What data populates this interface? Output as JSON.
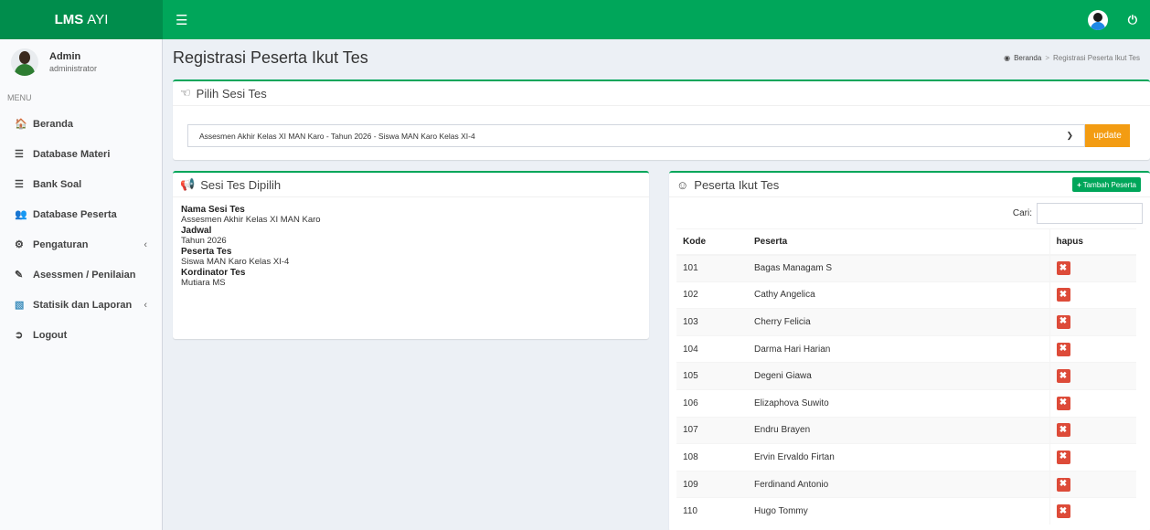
{
  "brand": {
    "bold": "LMS",
    "light": "AYI"
  },
  "user": {
    "name": "Admin",
    "role": "administrator"
  },
  "menu_header": "MENU",
  "sidebar": {
    "items": [
      {
        "label": "Beranda",
        "icon": "home-icon"
      },
      {
        "label": "Database Materi",
        "icon": "database-icon"
      },
      {
        "label": "Bank Soal",
        "icon": "database-icon"
      },
      {
        "label": "Database Peserta",
        "icon": "users-icon"
      },
      {
        "label": "Pengaturan",
        "icon": "gear-icon"
      },
      {
        "label": "Asessmen / Penilaian",
        "icon": "edit-icon"
      },
      {
        "label": "Statisik dan Laporan",
        "icon": "bar-chart-icon"
      },
      {
        "label": "Logout",
        "icon": "logout-icon"
      }
    ]
  },
  "page": {
    "title": "Registrasi Peserta Ikut Tes"
  },
  "breadcrumb": {
    "home": "Beranda",
    "current": "Registrasi Peserta Ikut Tes"
  },
  "pilih_sesi": {
    "title": "Pilih Sesi Tes",
    "selected": "Assesmen Akhir Kelas XI MAN Karo - Tahun 2026 - Siswa MAN Karo Kelas XI-4",
    "update_label": "update"
  },
  "sesi_dipilih": {
    "title": "Sesi Tes Dipilih",
    "nama_label": "Nama Sesi Tes",
    "nama_value": "Assesmen Akhir Kelas XI MAN Karo",
    "jadwal_label": "Jadwal",
    "jadwal_value": "Tahun 2026",
    "peserta_label": "Peserta Tes",
    "peserta_value": "Siswa MAN Karo Kelas XI-4",
    "kordinator_label": "Kordinator Tes",
    "kordinator_value": "Mutiara MS"
  },
  "peserta": {
    "title": "Peserta Ikut Tes",
    "add_label": "Tambah Peserta",
    "search_label": "Cari:",
    "columns": [
      "Kode",
      "Peserta",
      "hapus"
    ],
    "rows": [
      {
        "kode": "101",
        "nama": "Bagas Managam S"
      },
      {
        "kode": "102",
        "nama": "Cathy Angelica"
      },
      {
        "kode": "103",
        "nama": "Cherry Felicia"
      },
      {
        "kode": "104",
        "nama": "Darma Hari Harian"
      },
      {
        "kode": "105",
        "nama": "Degeni Giawa"
      },
      {
        "kode": "106",
        "nama": "Elizaphova Suwito"
      },
      {
        "kode": "107",
        "nama": "Endru Brayen"
      },
      {
        "kode": "108",
        "nama": "Ervin Ervaldo Firtan"
      },
      {
        "kode": "109",
        "nama": "Ferdinand Antonio"
      },
      {
        "kode": "110",
        "nama": "Hugo Tommy"
      }
    ]
  },
  "colors": {
    "primary": "#00a65a",
    "brand_bg": "#008d4c",
    "warning": "#f39c12",
    "danger": "#dd4b39"
  }
}
